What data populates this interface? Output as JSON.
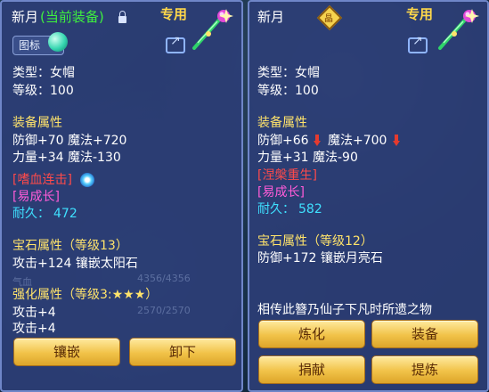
{
  "left_panel": {
    "name": "新月",
    "status": "(当前装备)",
    "exclusive": "专用",
    "icon_badge": "图标",
    "type_line": "类型：女帽",
    "level_line": "等级：100",
    "equip_attr_title": "装备属性",
    "attr_line1": "防御+70 魔法+720",
    "attr_line2": "力量+34 魔法-130",
    "skill_tag": "[嗜血连击]",
    "growth_tag": "[易成长]",
    "durability_label": "耐久：",
    "durability_value": "472",
    "gem_title": "宝石属性（等级13）",
    "gem_line": "攻击+124 镶嵌太阳石",
    "enhance_title": "强化属性（等级3:★★★）",
    "enhance_line1": "攻击+4",
    "enhance_line2": "攻击+4",
    "bg_faint_text": [
      "4356/4356",
      "2570/2570",
      "气血"
    ],
    "buttons": {
      "inlay": "镶嵌",
      "unequip": "卸下"
    }
  },
  "right_panel": {
    "name": "新月",
    "seal_glyph": "晶",
    "exclusive": "专用",
    "type_line": "类型：女帽",
    "level_line": "等级：100",
    "equip_attr_title": "装备属性",
    "attr_line1_a": "防御+66",
    "attr_line1_b": "魔法+700",
    "attr_line2": "力量+31 魔法-90",
    "nirvana_tag": "[涅槃重生]",
    "growth_tag": "[易成长]",
    "durability_label": "耐久：",
    "durability_value": "582",
    "gem_title": "宝石属性（等级12）",
    "gem_line": "防御+172 镶嵌月亮石",
    "description": "相传此簪乃仙子下凡时所遗之物",
    "buttons": {
      "refine": "炼化",
      "equip": "装备",
      "donate": "捐献",
      "extract": "提炼"
    }
  },
  "colors": {
    "panel_bg": "#2c3e76",
    "gold": "#ffd84a",
    "cyan": "#3fe0ff",
    "red_tag": "#ff4a4a",
    "magenta_tag": "#ff5cd8",
    "green": "#3ef03e",
    "button_gold": "#f1c248"
  }
}
